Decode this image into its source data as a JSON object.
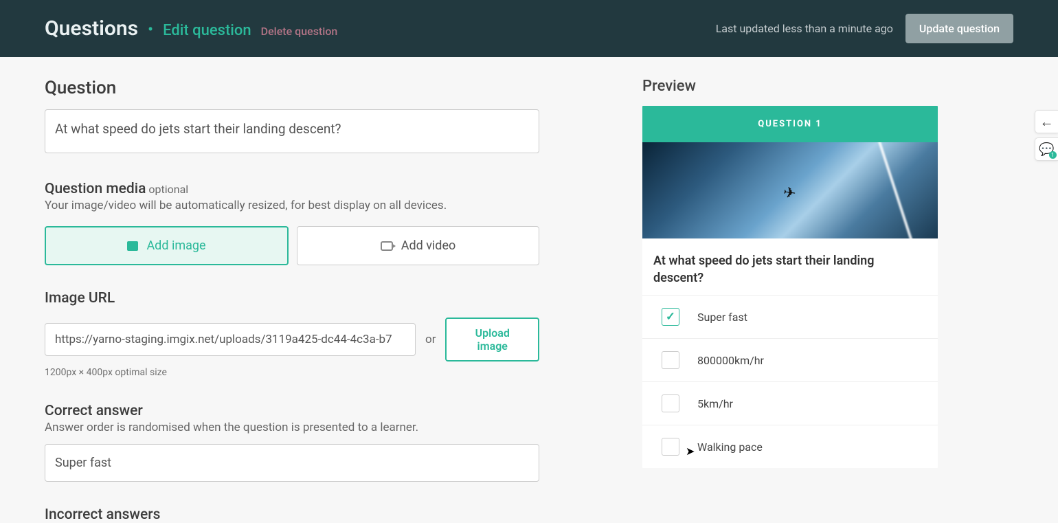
{
  "header": {
    "title": "Questions",
    "subtitle": "Edit question",
    "delete_label": "Delete question",
    "last_updated": "Last updated less than a minute ago",
    "update_button": "Update question"
  },
  "form": {
    "question_label": "Question",
    "question_text": "At what speed do jets start their landing descent?",
    "media_label": "Question media",
    "media_optional": "optional",
    "media_desc": "Your image/video will be automatically resized, for best display on all devices.",
    "add_image_label": "Add image",
    "add_video_label": "Add video",
    "image_url_label": "Image URL",
    "image_url_value": "https://yarno-staging.imgix.net/uploads/3119a425-dc44-4c3a-b7",
    "or_text": "or",
    "upload_label": "Upload image",
    "image_hint": "1200px × 400px optimal size",
    "correct_answer_label": "Correct answer",
    "correct_answer_desc": "Answer order is randomised when the question is presented to a learner.",
    "correct_answer_value": "Super fast",
    "incorrect_answers_label": "Incorrect answers"
  },
  "preview": {
    "label": "Preview",
    "banner": "QUESTION 1",
    "question": "At what speed do jets start their landing descent?",
    "options": [
      {
        "text": "Super fast",
        "checked": true
      },
      {
        "text": "800000km/hr",
        "checked": false
      },
      {
        "text": "5km/hr",
        "checked": false
      },
      {
        "text": "Walking pace",
        "checked": false
      }
    ]
  },
  "side": {
    "chat_badge": "1"
  }
}
